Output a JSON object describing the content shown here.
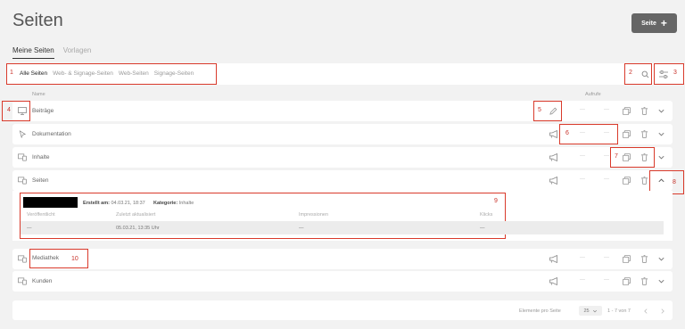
{
  "page": {
    "title": "Seiten",
    "new_button": "Seite"
  },
  "tabs": [
    {
      "label": "Meine Seiten"
    },
    {
      "label": "Vorlagen"
    }
  ],
  "filters": [
    "Alle Seiten",
    "Web- & Signage-Seiten",
    "Web-Seiten",
    "Signage-Seiten"
  ],
  "columns": {
    "name": "Name",
    "views": "Aufrufe"
  },
  "rows": [
    {
      "label": "Beiträge"
    },
    {
      "label": "Dokumentation"
    },
    {
      "label": "Inhalte"
    },
    {
      "label": "Seiten"
    },
    {
      "label": "Mediathek"
    },
    {
      "label": "Kunden"
    }
  ],
  "dash": "—",
  "detail": {
    "created_label": "Erstellt am:",
    "created_value": "04.03.21, 18:37",
    "category_label": "Kategorie:",
    "category_value": "Inhalte",
    "headers": [
      "Veröffentlicht",
      "Zuletzt aktualisiert",
      "Impressionen",
      "Klicks"
    ],
    "values": [
      "—",
      "05.03.21, 13:35 Uhr",
      "—",
      "—"
    ]
  },
  "footer": {
    "per_page_label": "Elemente pro Seite",
    "per_page": "25",
    "range": "1 - 7 von 7"
  },
  "annotations": [
    "1",
    "2",
    "3",
    "4",
    "5",
    "6",
    "7",
    "8",
    "9",
    "10"
  ]
}
